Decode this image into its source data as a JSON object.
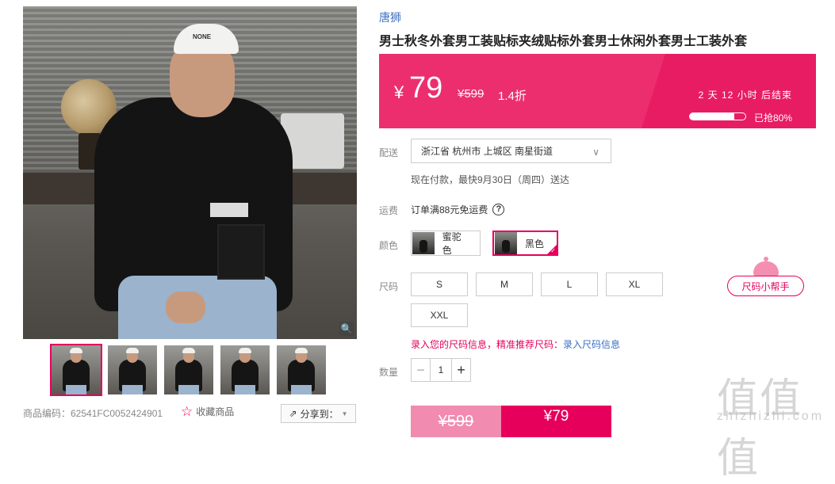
{
  "gallery": {
    "cap_text": "NONE",
    "sku_code": "商品编码：62541FC0052424901",
    "favorite_label": "收藏商品",
    "share_label": "分享到："
  },
  "product": {
    "brand": "唐狮",
    "title": "男士秋冬外套男工装贴标夹绒贴标外套男士休闲外套男士工装外套"
  },
  "price": {
    "currency": "¥",
    "current": "79",
    "original": "¥599",
    "discount": "1.4折",
    "countdown": "2 天 12 小时 后结束",
    "sold_label": "已抢80%",
    "sold_fraction": 0.8
  },
  "delivery": {
    "label": "配送",
    "address": "浙江省 杭州市 上城区 南星街道",
    "note": "现在付款，最快9月30日（周四）送达"
  },
  "shipping": {
    "label": "运费",
    "text": "订单满88元免运费"
  },
  "colors": {
    "label": "颜色",
    "options": [
      {
        "name": "蜜驼色",
        "selected": false
      },
      {
        "name": "黑色",
        "selected": true
      }
    ]
  },
  "sizes": {
    "label": "尺码",
    "options": [
      "S",
      "M",
      "L",
      "XL",
      "XXL"
    ],
    "helper_label": "尺码小帮手",
    "hint_text": "录入您的尺码信息，精准推荐尺码：",
    "hint_link": "录入尺码信息"
  },
  "quantity": {
    "label": "数量",
    "value": "1"
  },
  "buy": {
    "original_price": "¥599",
    "current_price": "¥79"
  },
  "watermark": {
    "glyphs": "值值值",
    "site": "zhizhizhi.com"
  },
  "colors_theme": {
    "accent": "#e6005c",
    "price_bar": "#ec2e6e",
    "link": "#3a6fc4"
  }
}
